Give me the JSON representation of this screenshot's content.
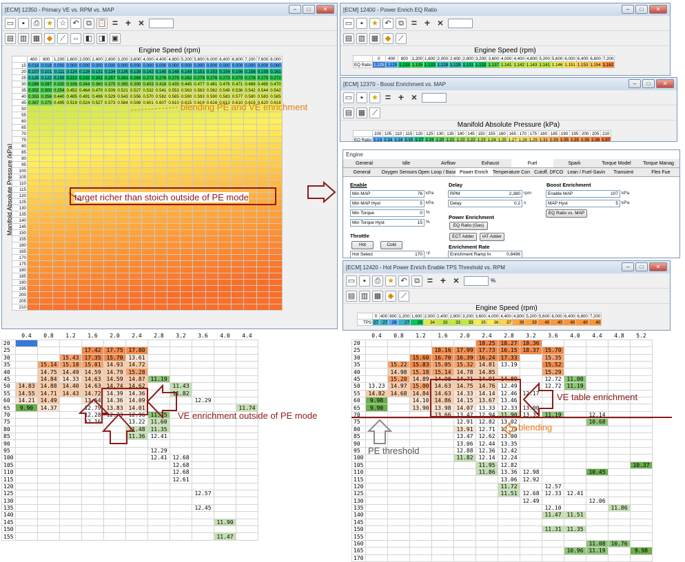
{
  "ve_window": {
    "title": "[ECM] 12350 - Primary VE vs. RPM vs. MAP",
    "x_axis_title": "Engine Speed (rpm)",
    "y_axis_title": "Manifold Absolute Pressure (kPa)",
    "rpm": [
      "400",
      "800",
      "1,200",
      "1,600",
      "2,000",
      "2,400",
      "2,800",
      "3,200",
      "3,600",
      "4,000",
      "4,400",
      "4,800",
      "5,200",
      "5,600",
      "6,000",
      "6,400",
      "6,800",
      "7,200",
      "7,600",
      "8,000"
    ],
    "map": [
      "15",
      "20",
      "25",
      "30",
      "35",
      "40",
      "45",
      "50",
      "55",
      "60",
      "65",
      "70",
      "75",
      "80",
      "85",
      "90",
      "95",
      "100",
      "105",
      "110",
      "115",
      "120",
      "125",
      "130",
      "135",
      "140",
      "145",
      "150",
      "155",
      "160",
      "165",
      "170",
      "175",
      "180",
      "185",
      "190",
      "195",
      "200",
      "205",
      "210"
    ],
    "first_rows": [
      [
        "0.018",
        "0.018",
        "0.000",
        "0.000",
        "0.000",
        "0.000",
        "0.000",
        "0.000",
        "0.000",
        "0.000",
        "0.000",
        "0.000",
        "0.000",
        "0.000",
        "0.000",
        "0.000",
        "0.000",
        "0.000",
        "0.000",
        "0.000"
      ],
      [
        "0.107",
        "0.101",
        "0.111",
        "0.124",
        "0.128",
        "0.131",
        "0.134",
        "0.136",
        "0.139",
        "0.142",
        "0.145",
        "0.148",
        "0.149",
        "0.151",
        "0.153",
        "0.154",
        "0.156",
        "0.158",
        "0.159",
        "0.161"
      ],
      [
        "0.125",
        "0.122",
        "0.155",
        "0.210",
        "0.232",
        "0.241",
        "0.257",
        "0.263",
        "0.269",
        "0.272",
        "0.276",
        "0.279",
        "0.282",
        "0.279",
        "0.276",
        "0.273",
        "0.270",
        "0.278",
        "0.275",
        "0.272"
      ],
      [
        "0.289",
        "0.287",
        "0.320",
        "0.336",
        "0.344",
        "0.360",
        "0.375",
        "0.385",
        "0.399",
        "0.403",
        "0.416",
        "0.435",
        "0.445",
        "0.477",
        "0.481",
        "0.476",
        "0.471",
        "0.468",
        "0.465",
        "0.470"
      ],
      [
        "0.302",
        "0.300",
        "0.354",
        "0.452",
        "0.464",
        "0.470",
        "0.509",
        "0.521",
        "0.527",
        "0.532",
        "0.541",
        "0.553",
        "0.563",
        "0.563",
        "0.562",
        "0.549",
        "0.536",
        "0.542",
        "0.544",
        "0.542"
      ],
      [
        "0.353",
        "0.356",
        "0.440",
        "0.485",
        "0.491",
        "0.496",
        "0.529",
        "0.543",
        "0.556",
        "0.570",
        "0.582",
        "0.585",
        "0.590",
        "0.593",
        "0.590",
        "0.583",
        "0.577",
        "0.580",
        "0.583",
        "0.585"
      ],
      [
        "0.367",
        "0.375",
        "0.495",
        "0.519",
        "0.524",
        "0.527",
        "0.573",
        "0.584",
        "0.598",
        "0.601",
        "0.607",
        "0.610",
        "0.615",
        "0.618",
        "0.616",
        "0.613",
        "0.610",
        "0.619",
        "0.620",
        "0.618"
      ]
    ]
  },
  "annotations": {
    "blend": "blending PE and VE enrichment",
    "richer": "target richer than stoich outside of PE mode",
    "ve_outside": "VE enrichment outside of PE mode",
    "ve_table": "VE table enrichment",
    "blending": "blending",
    "pe_threshold": "PE threshold"
  },
  "eq_window": {
    "title": "[ECM] 12400 - Power Enrich EQ Ratio",
    "axis_title": "Engine Speed (rpm)",
    "row_label": "EQ Ratio",
    "rpm": [
      "0",
      "400",
      "800",
      "1,200",
      "1,600",
      "2,000",
      "2,400",
      "2,800",
      "3,200",
      "3,600",
      "4,000",
      "4,400",
      "4,800",
      "5,200",
      "5,600",
      "6,000",
      "6,400",
      "6,800",
      "7,200"
    ],
    "values": [
      "1.125",
      "1.125",
      "1.133",
      "1.135",
      "1.133",
      "1.128",
      "1.129",
      "1.131",
      "1.132",
      "1.137",
      "1.141",
      "1.142",
      "1.143",
      "1.141",
      "1.146",
      "1.151",
      "1.153",
      "1.154",
      "1.162"
    ]
  },
  "boost_window": {
    "title": "[ECM] 12370 - Boost Enrichment vs. MAP",
    "axis_title": "Manifold Absolute Pressure (kPa)",
    "row_label": "EQ Ratio",
    "kpa": [
      "100",
      "105",
      "110",
      "115",
      "120",
      "125",
      "130",
      "135",
      "140",
      "145",
      "150",
      "155",
      "160",
      "165",
      "170",
      "175",
      "180",
      "185",
      "190",
      "195",
      "200",
      "205",
      "210"
    ],
    "values": [
      "1.13",
      "1.14",
      "1.14",
      "1.15",
      "1.17",
      "1.19",
      "1.20",
      "1.21",
      "1.22",
      "1.22",
      "1.23",
      "1.24",
      "1.25",
      "1.27",
      "1.28",
      "1.29",
      "1.31",
      "1.33",
      "1.35",
      "1.35",
      "1.35",
      "1.36",
      "1.37"
    ]
  },
  "engine_window": {
    "title": "Engine",
    "tabs_row1": [
      "General",
      "Idle",
      "Airflow",
      "Exhaust",
      "Fuel",
      "Spark",
      "Torque Model",
      "Torque Manag"
    ],
    "tabs_row2": [
      "General",
      "Oxygen Sensors",
      "Open Loop / Base",
      "Power Enrich",
      "Temperature Contr",
      "Cutoff, DFCO",
      "Lean / Fuel-Saving",
      "Transient",
      "Flex Fue"
    ],
    "enable": {
      "label": "Enable",
      "min_map": "Min MAP",
      "min_map_val": "76",
      "min_map_unit": "kPa",
      "min_map_hyst": "Min MAP Hyst",
      "min_map_hyst_val": "5",
      "min_map_hyst_unit": "kPa",
      "min_torque": "Min Torque",
      "min_torque_val": "0",
      "min_torque_unit": "%",
      "min_torque_hyst": "Min Torque Hyst",
      "min_torque_hyst_val": "15",
      "min_torque_hyst_unit": "%"
    },
    "delay": {
      "label": "Delay",
      "rpm": "RPM",
      "rpm_val": "2,380",
      "rpm_unit": "rpm",
      "delay": "Delay",
      "delay_val": "0.2",
      "delay_unit": "s"
    },
    "boost": {
      "label": "Boost Enrichment",
      "enable_map": "Enable MAP",
      "enable_map_val": "107",
      "enable_map_unit": "kPa",
      "map_hyst": "MAP Hyst",
      "map_hyst_val": "5",
      "map_hyst_unit": "kPa",
      "eq_btn": "EQ Ratio vs. MAP"
    },
    "pe": {
      "label": "Power Enrichment",
      "eq_btn": "EQ Ratio (Gas)",
      "ect_btn": "ECT Adder",
      "iat_btn": "IAT Adder"
    },
    "throttle": {
      "label": "Throttle",
      "hot": "Hot",
      "cold": "Cold",
      "hot_select": "Hot Select",
      "hot_select_val": "170",
      "hot_select_unit": "°F"
    },
    "rate": {
      "label": "Enrichment Rate",
      "ramp_in": "Enrichment Ramp In",
      "ramp_in_val": "0.8496"
    }
  },
  "tps_window": {
    "title": "[ECM] 12420 - Hot Power Enrich Enable TPS Threshold vs. RPM",
    "axis_title": "Engine Speed (rpm)",
    "row_label": "TPS",
    "toolbar_unit": "%",
    "rpm": [
      "0",
      "400",
      "800",
      "1,200",
      "1,600",
      "2,000",
      "2,400",
      "2,800",
      "3,200",
      "3,600",
      "4,000",
      "4,400",
      "4,800",
      "5,200",
      "5,600",
      "6,000",
      "6,400",
      "6,800",
      "7,200"
    ],
    "values": [
      "27",
      "27",
      "26",
      "27",
      "29",
      "34",
      "33",
      "33",
      "33",
      "35",
      "36",
      "37",
      "39",
      "39",
      "40",
      "40",
      "40",
      "40",
      "40"
    ]
  },
  "bottom_left": {
    "cols": [
      "0.4",
      "0.8",
      "1.2",
      "1.6",
      "2.0",
      "2.4",
      "2.8",
      "3.2",
      "3.6",
      "4.0",
      "4.4"
    ],
    "rows": [
      "20",
      "25",
      "30",
      "35",
      "40",
      "45",
      "50",
      "55",
      "60",
      "65",
      "70",
      "75",
      "80",
      "85",
      "90",
      "95",
      "100",
      "105",
      "110",
      "115",
      "120",
      "125",
      "130",
      "135",
      "140",
      "145",
      "150",
      "155"
    ],
    "cells": [
      [
        "",
        "",
        "",
        "",
        "",
        "",
        "",
        "",
        "",
        "",
        ""
      ],
      [
        "",
        "",
        "",
        "17.42",
        "17.75",
        "17.80",
        "",
        "",
        "",
        "",
        ""
      ],
      [
        "",
        "",
        "15.43",
        "17.35",
        "15.70",
        "13.61",
        "",
        "",
        "",
        "",
        ""
      ],
      [
        "",
        "15.14",
        "15.18",
        "15.01",
        "14.93",
        "14.72",
        "",
        "",
        "",
        "",
        ""
      ],
      [
        "",
        "14.75",
        "14.49",
        "14.59",
        "14.79",
        "15.28",
        "",
        "",
        "",
        "",
        ""
      ],
      [
        "",
        "14.84",
        "14.33",
        "14.63",
        "14.59",
        "14.87",
        "11.19",
        "",
        "",
        "",
        ""
      ],
      [
        "14.83",
        "14.88",
        "14.40",
        "14.63",
        "14.74",
        "14.62",
        "",
        "11.43",
        "",
        "",
        ""
      ],
      [
        "14.55",
        "14.71",
        "14.43",
        "14.72",
        "14.39",
        "14.36",
        "",
        "11.82",
        "",
        "",
        ""
      ],
      [
        "14.21",
        "14.49",
        "",
        "13.54",
        "14.36",
        "14.09",
        "",
        "",
        "12.29",
        "",
        ""
      ],
      [
        "9.90",
        "14.37",
        "",
        "12.79",
        "13.83",
        "14.01",
        "",
        "",
        "",
        "",
        "11.74"
      ],
      [
        "",
        "",
        "",
        "12.28",
        "12.73",
        "12.96",
        "11.15",
        "",
        "",
        "",
        ""
      ],
      [
        "",
        "",
        "",
        "12.16",
        "",
        "13.22",
        "11.60",
        "",
        "",
        "",
        ""
      ],
      [
        "",
        "",
        "",
        "",
        "",
        "11.48",
        "11.35",
        "",
        "",
        "",
        ""
      ],
      [
        "",
        "",
        "",
        "",
        "",
        "11.36",
        "12.41",
        "",
        "",
        "",
        ""
      ],
      [
        "",
        "",
        "",
        "",
        "",
        "",
        "",
        "",
        "",
        "",
        ""
      ],
      [
        "",
        "",
        "",
        "",
        "",
        "",
        "12.29",
        "",
        "",
        "",
        ""
      ],
      [
        "",
        "",
        "",
        "",
        "",
        "",
        "12.41",
        "12.68",
        "",
        "",
        ""
      ],
      [
        "",
        "",
        "",
        "",
        "",
        "",
        "",
        "12.68",
        "",
        "",
        ""
      ],
      [
        "",
        "",
        "",
        "",
        "",
        "",
        "",
        "12.68",
        "",
        "",
        ""
      ],
      [
        "",
        "",
        "",
        "",
        "",
        "",
        "",
        "12.61",
        "",
        "",
        ""
      ],
      [
        "",
        "",
        "",
        "",
        "",
        "",
        "",
        "",
        "",
        "",
        ""
      ],
      [
        "",
        "",
        "",
        "",
        "",
        "",
        "",
        "",
        "12.57",
        "",
        ""
      ],
      [
        "",
        "",
        "",
        "",
        "",
        "",
        "",
        "",
        "",
        "",
        ""
      ],
      [
        "",
        "",
        "",
        "",
        "",
        "",
        "",
        "",
        "12.45",
        "",
        ""
      ],
      [
        "",
        "",
        "",
        "",
        "",
        "",
        "",
        "",
        "",
        "",
        ""
      ],
      [
        "",
        "",
        "",
        "",
        "",
        "",
        "",
        "",
        "",
        "11.90",
        ""
      ],
      [
        "",
        "",
        "",
        "",
        "",
        "",
        "",
        "",
        "",
        "",
        ""
      ],
      [
        "",
        "",
        "",
        "",
        "",
        "",
        "",
        "",
        "",
        "11.47",
        ""
      ]
    ]
  },
  "bottom_right": {
    "cols": [
      "0.4",
      "0.8",
      "1.2",
      "1.6",
      "2.0",
      "2.4",
      "2.8",
      "3.2",
      "3.6",
      "4.0",
      "4.4",
      "4.8",
      "5.2"
    ],
    "rows": [
      "20",
      "25",
      "30",
      "35",
      "40",
      "45",
      "50",
      "55",
      "60",
      "65",
      "70",
      "75",
      "80",
      "85",
      "90",
      "95",
      "100",
      "105",
      "110",
      "115",
      "120",
      "125",
      "130",
      "135",
      "140",
      "145",
      "150",
      "155",
      "160",
      "165",
      "170"
    ],
    "cells": [
      [
        "",
        "",
        "",
        "",
        "",
        "18.25",
        "18.27",
        "18.36",
        "",
        "",
        "",
        "",
        ""
      ],
      [
        "",
        "",
        "",
        "18.16",
        "17.99",
        "17.73",
        "16.15",
        "18.37",
        "15.70",
        "",
        "",
        "",
        ""
      ],
      [
        "",
        "",
        "15.60",
        "16.70",
        "16.39",
        "16.24",
        "17.33",
        "",
        "15.35",
        "",
        "",
        "",
        ""
      ],
      [
        "",
        "15.22",
        "15.83",
        "15.05",
        "15.32",
        "14.81",
        "13.19",
        "",
        "15.52",
        "",
        "",
        "",
        ""
      ],
      [
        "",
        "14.98",
        "15.18",
        "15.14",
        "14.78",
        "14.85",
        "",
        "",
        "15.29",
        "",
        "",
        "",
        ""
      ],
      [
        "",
        "15.20",
        "14.89",
        "14.98",
        "14.71",
        "14.91",
        "14.89",
        "",
        "12.72",
        "11.00",
        "",
        "",
        ""
      ],
      [
        "13.23",
        "14.97",
        "15.00",
        "14.63",
        "14.75",
        "14.76",
        "12.49",
        "",
        "12.72",
        "11.19",
        "",
        "",
        ""
      ],
      [
        "14.82",
        "14.68",
        "14.84",
        "14.63",
        "14.33",
        "14.14",
        "12.46",
        "12.17",
        "",
        "",
        "",
        "",
        ""
      ],
      [
        "9.98",
        "",
        "14.10",
        "14.86",
        "14.15",
        "13.67",
        "13.46",
        "",
        "",
        "",
        "",
        "",
        ""
      ],
      [
        "9.90",
        "",
        "13.90",
        "13.98",
        "14.07",
        "13.33",
        "12.33",
        "13.00",
        "",
        "",
        "",
        "",
        ""
      ],
      [
        "",
        "",
        "",
        "13.66",
        "13.47",
        "12.94",
        "11.90",
        "13.35",
        "11.19",
        "",
        "12.14",
        "",
        ""
      ],
      [
        "",
        "",
        "",
        "",
        "12.91",
        "12.82",
        "13.02",
        "",
        "",
        "",
        "10.68",
        "",
        ""
      ],
      [
        "",
        "",
        "",
        "",
        "13.91",
        "12.71",
        "12.79",
        "",
        "",
        "",
        "",
        "",
        ""
      ],
      [
        "",
        "",
        "",
        "",
        "13.47",
        "12.62",
        "13.00",
        "",
        "",
        "",
        "",
        "",
        ""
      ],
      [
        "",
        "",
        "",
        "",
        "13.06",
        "12.44",
        "13.35",
        "",
        "",
        "",
        "",
        "",
        ""
      ],
      [
        "",
        "",
        "",
        "",
        "12.88",
        "12.36",
        "12.42",
        "",
        "",
        "",
        "",
        "",
        ""
      ],
      [
        "",
        "",
        "",
        "",
        "11.82",
        "12.14",
        "12.24",
        "",
        "",
        "",
        "",
        "",
        ""
      ],
      [
        "",
        "",
        "",
        "",
        "",
        "11.95",
        "12.82",
        "",
        "",
        "",
        "",
        "",
        "10.37"
      ],
      [
        "",
        "",
        "",
        "",
        "",
        "11.86",
        "13.36",
        "12.98",
        "",
        "",
        "10.45",
        "",
        ""
      ],
      [
        "",
        "",
        "",
        "",
        "",
        "",
        "13.06",
        "12.92",
        "",
        "",
        "",
        "",
        ""
      ],
      [
        "",
        "",
        "",
        "",
        "",
        "",
        "11.72",
        "",
        "12.57",
        "",
        "",
        "",
        ""
      ],
      [
        "",
        "",
        "",
        "",
        "",
        "",
        "11.51",
        "12.68",
        "12.33",
        "12.41",
        "",
        "",
        ""
      ],
      [
        "",
        "",
        "",
        "",
        "",
        "",
        "",
        "12.49",
        "",
        "",
        "12.06",
        "",
        ""
      ],
      [
        "",
        "",
        "",
        "",
        "",
        "",
        "",
        "",
        "12.10",
        "",
        "",
        "11.86",
        ""
      ],
      [
        "",
        "",
        "",
        "",
        "",
        "",
        "",
        "",
        "11.47",
        "11.51",
        "",
        "",
        ""
      ],
      [
        "",
        "",
        "",
        "",
        "",
        "",
        "",
        "",
        "",
        "",
        "",
        "",
        ""
      ],
      [
        "",
        "",
        "",
        "",
        "",
        "",
        "",
        "",
        "11.31",
        "11.35",
        "",
        "",
        ""
      ],
      [
        "",
        "",
        "",
        "",
        "",
        "",
        "",
        "",
        "",
        "",
        "",
        "",
        ""
      ],
      [
        "",
        "",
        "",
        "",
        "",
        "",
        "",
        "",
        "",
        "",
        "11.08",
        "10.76",
        ""
      ],
      [
        "",
        "",
        "",
        "",
        "",
        "",
        "",
        "",
        "",
        "10.96",
        "11.19",
        "",
        "9.98"
      ]
    ]
  },
  "colors": {
    "highlight_select": "#3a78d8",
    "annotation_dark": "#8b1a1a",
    "annotation_orange": "#e87b1c"
  }
}
